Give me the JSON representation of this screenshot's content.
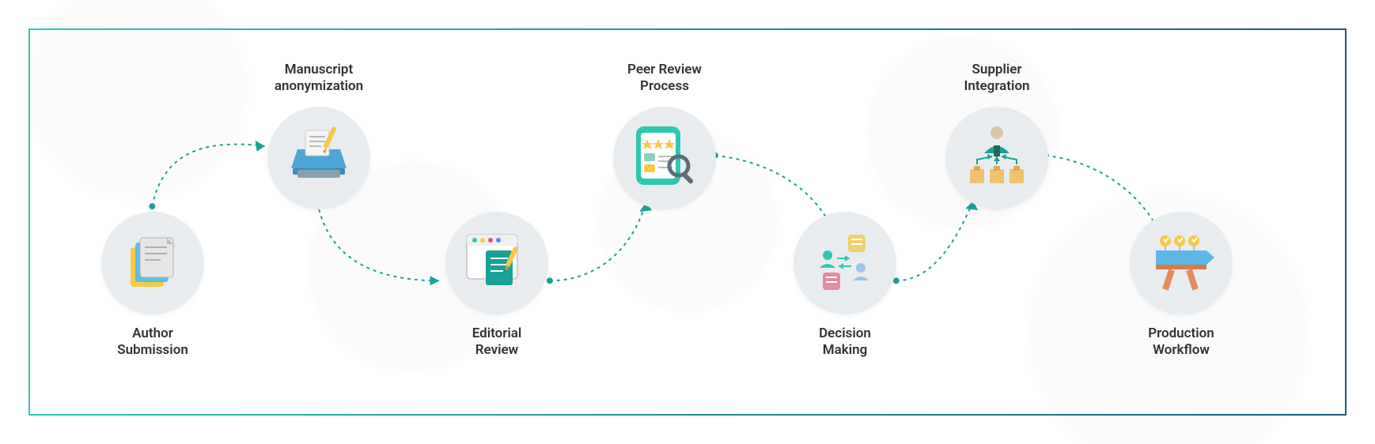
{
  "diagram": {
    "steps": [
      {
        "id": "author-submission",
        "label": "Author\nSubmission"
      },
      {
        "id": "manuscript-anonymization",
        "label": "Manuscript\nanonymization"
      },
      {
        "id": "editorial-review",
        "label": "Editorial\nReview"
      },
      {
        "id": "peer-review-process",
        "label": "Peer Review\nProcess"
      },
      {
        "id": "decision-making",
        "label": "Decision\nMaking"
      },
      {
        "id": "supplier-integration",
        "label": "Supplier\nIntegration"
      },
      {
        "id": "production-workflow",
        "label": "Production\nWorkflow"
      }
    ],
    "accent_color": "#1aa097"
  }
}
